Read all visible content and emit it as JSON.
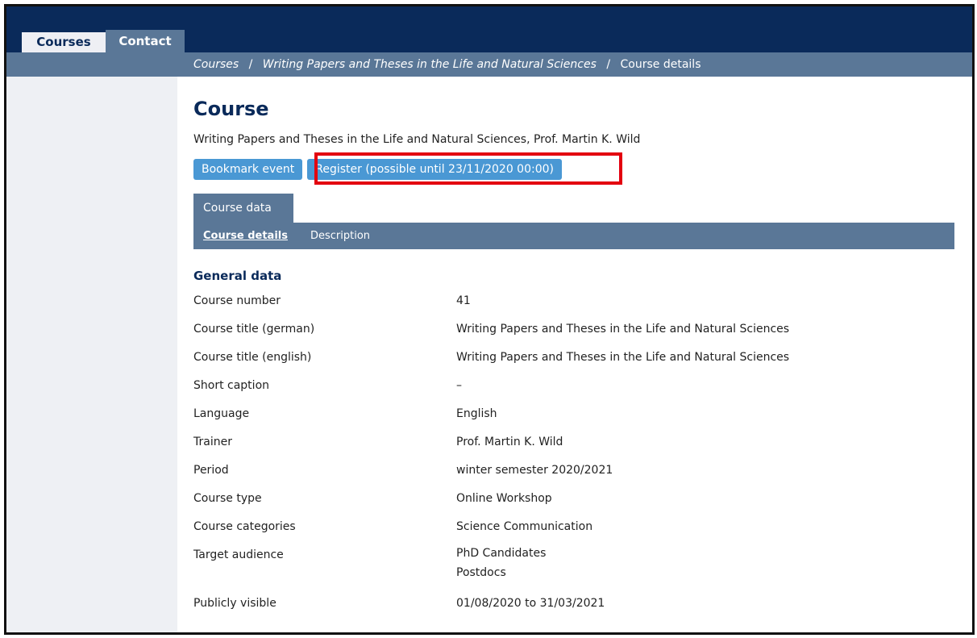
{
  "nav": {
    "tabs": [
      {
        "label": "Courses"
      },
      {
        "label": "Contact"
      }
    ]
  },
  "breadcrumb": {
    "items": [
      "Courses",
      "Writing Papers and Theses in the Life and Natural Sciences",
      "Course details"
    ],
    "separator": "/"
  },
  "page": {
    "title": "Course",
    "subtitle": "Writing Papers and Theses in the Life and Natural Sciences, Prof. Martin K. Wild"
  },
  "actions": {
    "bookmark_label": "Bookmark event",
    "register_label": "Register (possible until 23/11/2020 00:00)"
  },
  "course_tab": {
    "label": "Course data"
  },
  "subtabs": [
    {
      "label": "Course details",
      "active": true
    },
    {
      "label": "Description",
      "active": false
    }
  ],
  "general": {
    "title": "General data",
    "rows": [
      {
        "label": "Course number",
        "value": "41"
      },
      {
        "label": "Course title (german)",
        "value": "Writing Papers and Theses in the Life and Natural Sciences"
      },
      {
        "label": "Course title (english)",
        "value": "Writing Papers and Theses in the Life and Natural Sciences"
      },
      {
        "label": "Short caption",
        "value": "–"
      },
      {
        "label": "Language",
        "value": "English"
      },
      {
        "label": "Trainer",
        "value": "Prof. Martin K. Wild"
      },
      {
        "label": "Period",
        "value": "winter semester 2020/2021"
      },
      {
        "label": "Course type",
        "value": "Online Workshop"
      },
      {
        "label": "Course categories",
        "value": "Science Communication"
      },
      {
        "label": "Target audience",
        "values": [
          "PhD Candidates",
          "Postdocs"
        ]
      },
      {
        "label": "Publicly visible",
        "value": "01/08/2020 to 31/03/2021"
      }
    ]
  },
  "colors": {
    "navy": "#0a2a5a",
    "bar": "#5a7797",
    "button": "#4a98d4",
    "highlight": "#e3000f"
  }
}
